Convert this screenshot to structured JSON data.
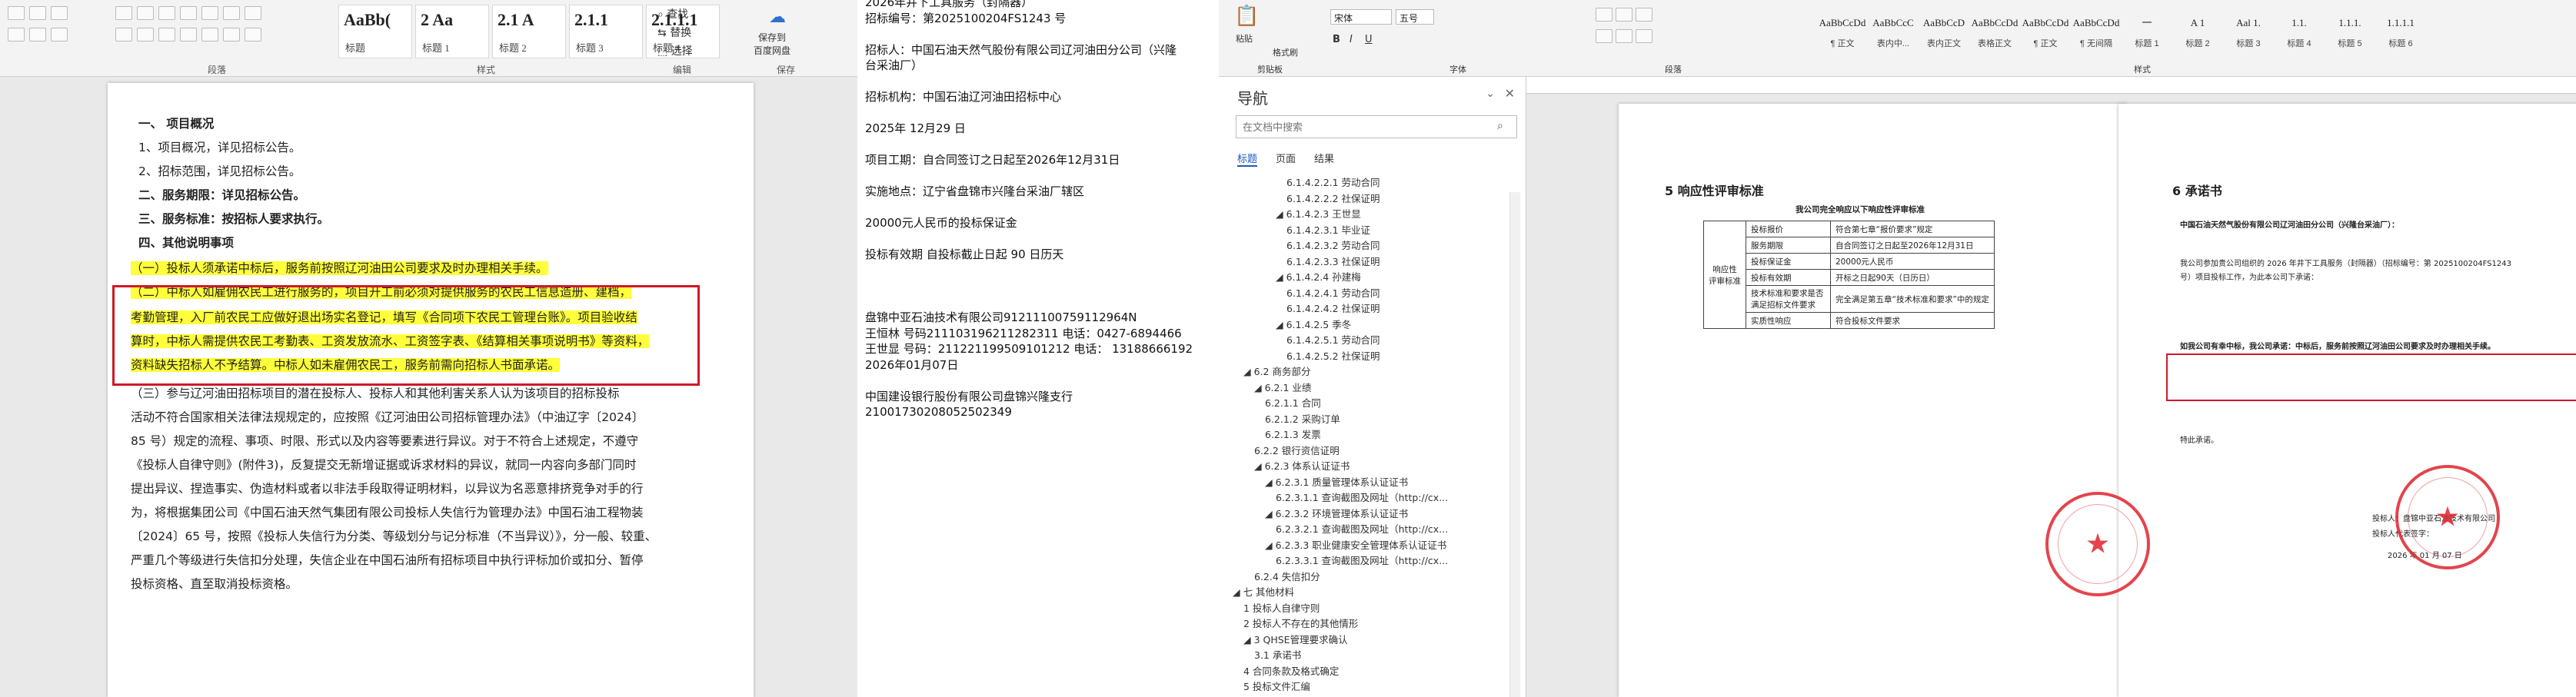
{
  "left_window": {
    "ribbon": {
      "styles": [
        {
          "sample": "AaBb(",
          "label": "标题"
        },
        {
          "sample": "2 Aa",
          "label": "标题 1"
        },
        {
          "sample": "2.1 A",
          "label": "标题 2"
        },
        {
          "sample": "2.1.1",
          "label": "标题 3"
        },
        {
          "sample": "2.1.1.1",
          "label": "标题 4"
        }
      ],
      "find": "查找",
      "replace": "替换",
      "select": "选择",
      "save_to": "保存到\n百度网盘",
      "group_paragraph": "段落",
      "group_styles": "样式",
      "group_edit": "编辑",
      "group_save": "保存"
    },
    "doc": {
      "lines": [
        {
          "text": "一、 项目概况",
          "bold": true
        },
        {
          "text": "1、项目概况，详见招标公告。"
        },
        {
          "text": "2、招标范围，详见招标公告。"
        },
        {
          "text": "二、服务期限：详见招标公告。",
          "bold": true
        },
        {
          "text": "三、服务标准：按招标人要求执行。",
          "bold": true
        },
        {
          "text": "四、其他说明事项",
          "bold": true
        },
        {
          "text": "（一）投标人须承诺中标后，服务前按照辽河油田公司要求及时办理相关手续。",
          "hl": true
        },
        {
          "text": "（二）中标人如雇佣农民工进行服务的，项目开工前必须对提供服务的农民工信息造册、建档，",
          "hl": true
        },
        {
          "text": "考勤管理，入厂前农民工应做好退出场实名登记，填写《合同项下农民工管理台账》。项目验收结",
          "hl": true
        },
        {
          "text": "算时，中标人需提供农民工考勤表、工资发放流水、工资签字表、《结算相关事项说明书》等资料，",
          "hl": true
        },
        {
          "text": "资料缺失招标人不予结算。中标人如未雇佣农民工，服务前需向招标人书面承诺。",
          "hl": true
        },
        {
          "text": "（三）参与辽河油田招标项目的潜在投标人、投标人和其他利害关系人认为该项目的招标投标"
        },
        {
          "text": "活动不符合国家相关法律法规规定的，应按照《辽河油田公司招标管理办法》（中油辽字〔2024〕"
        },
        {
          "text": "85 号）规定的流程、事项、时限、形式以及内容等要素进行异议。对于不符合上述规定，不遵守"
        },
        {
          "text": "《投标人自律守则》(附件3)，反复提交无新增证据或诉求材料的异议，就同一内容向多部门同时"
        },
        {
          "text": "提出异议、捏造事实、伪造材料或者以非法手段取得证明材料，以异议为名恶意排挤竞争对手的行"
        },
        {
          "text": "为，将根据集团公司《中国石油天然气集团有限公司投标人失信行为管理办法》中国石油工程物装"
        },
        {
          "text": "〔2024〕65 号，按照《投标人失信行为分类、等级划分与记分标准（不当异议）》，分一般、较重、"
        },
        {
          "text": "严重几个等级进行失信扣分处理，失信企业在中国石油所有招标项目中执行评标加价或扣分、暂停"
        },
        {
          "text": "投标资格、直至取消投标资格。"
        }
      ]
    }
  },
  "middle_text": {
    "lines": [
      "2026年井下工具服务（封隔器）",
      "招标编号：第2025100204FS1243 号",
      "",
      "招标人：中国石油天然气股份有限公司辽河油田分公司（兴隆",
      "台采油厂）",
      "",
      "招标机构：中国石油辽河油田招标中心",
      "",
      "2025年 12月29 日",
      "",
      "项目工期：自合同签订之日起至2026年12月31日",
      "",
      "实施地点：辽宁省盘锦市兴隆台采油厂辖区",
      "",
      "20000元人民币的投标保证金",
      "",
      "投标有效期              自投标截止日起  90  日历天",
      "",
      "",
      "",
      "盘锦中亚石油技术有限公司91211100759112964N",
      "王恒林  号码211103196211282311 电话：0427-6894466",
      "王世显  号码：211221199509101212  电话： 13188666192",
      "        2026年01月07日",
      "",
      "中国建设银行股份有限公司盘锦兴隆支行",
      "21001730208052502349"
    ]
  },
  "right_window": {
    "ribbon": {
      "font_name": "宋体",
      "font_size": "五号",
      "paste": "粘贴",
      "format_painter": "格式刷",
      "group_clipboard": "剪贴板",
      "group_font": "字体",
      "group_paragraph": "段落",
      "group_styles": "样式",
      "styles": [
        {
          "sample": "AaBbCcDd",
          "label": "¶ 正文"
        },
        {
          "sample": "AaBbCcC",
          "label": "表内中..."
        },
        {
          "sample": "AaBbCcD",
          "label": "表内正文"
        },
        {
          "sample": "AaBbCcDd",
          "label": "表格正文"
        },
        {
          "sample": "AaBbCcDd",
          "label": "¶ 正文"
        },
        {
          "sample": "AaBbCcDd",
          "label": "¶ 无间隔"
        },
        {
          "sample": "一",
          "label": "标题 1"
        },
        {
          "sample": "A 1",
          "label": "标题 2"
        },
        {
          "sample": "Aal 1.",
          "label": "标题 3"
        },
        {
          "sample": "1.1.",
          "label": "标题 4"
        },
        {
          "sample": "1.1.1.",
          "label": "标题 5"
        },
        {
          "sample": "1.1.1.1",
          "label": "标题 6"
        }
      ]
    },
    "nav": {
      "title": "导航",
      "search_placeholder": "在文档中搜索",
      "tabs": [
        "标题",
        "页面",
        "结果"
      ],
      "items": [
        {
          "text": "6.1.4.2.2.1 劳动合同",
          "level": 5
        },
        {
          "text": "6.1.4.2.2.2 社保证明",
          "level": 5
        },
        {
          "text": "◢ 6.1.4.2.3 王世显",
          "level": 4
        },
        {
          "text": "6.1.4.2.3.1 毕业证",
          "level": 5
        },
        {
          "text": "6.1.4.2.3.2 劳动合同",
          "level": 5
        },
        {
          "text": "6.1.4.2.3.3 社保证明",
          "level": 5
        },
        {
          "text": "◢ 6.1.4.2.4 孙建梅",
          "level": 4
        },
        {
          "text": "6.1.4.2.4.1 劳动合同",
          "level": 5
        },
        {
          "text": "6.1.4.2.4.2 社保证明",
          "level": 5
        },
        {
          "text": "◢ 6.1.4.2.5 季冬",
          "level": 4
        },
        {
          "text": "6.1.4.2.5.1 劳动合同",
          "level": 5
        },
        {
          "text": "6.1.4.2.5.2 社保证明",
          "level": 5
        },
        {
          "text": "◢ 6.2 商务部分",
          "level": 1
        },
        {
          "text": "◢ 6.2.1 业绩",
          "level": 2
        },
        {
          "text": "6.2.1.1 合同",
          "level": 3
        },
        {
          "text": "6.2.1.2 采购订单",
          "level": 3
        },
        {
          "text": "6.2.1.3 发票",
          "level": 3
        },
        {
          "text": "6.2.2 银行资信证明",
          "level": 2
        },
        {
          "text": "◢ 6.2.3 体系认证证书",
          "level": 2
        },
        {
          "text": "◢ 6.2.3.1 质量管理体系认证证书",
          "level": 3
        },
        {
          "text": "6.2.3.1.1 查询截图及网址（http://cx...",
          "level": 4
        },
        {
          "text": "◢ 6.2.3.2 环境管理体系认证证书",
          "level": 3
        },
        {
          "text": "6.2.3.2.1 查询截图及网址（http://cx...",
          "level": 4
        },
        {
          "text": "◢ 6.2.3.3 职业健康安全管理体系认证证书",
          "level": 3
        },
        {
          "text": "6.2.3.3.1 查询截图及网址（http://cx...",
          "level": 4
        },
        {
          "text": "6.2.4 失信扣分",
          "level": 2
        },
        {
          "text": "◢ 七 其他材料",
          "level": 0
        },
        {
          "text": "1 投标人自律守则",
          "level": 1
        },
        {
          "text": "2 投标人不存在的其他情形",
          "level": 1
        },
        {
          "text": "◢ 3 QHSE管理要求确认",
          "level": 1
        },
        {
          "text": "3.1 承诺书",
          "level": 2
        },
        {
          "text": "4 合同条款及格式确定",
          "level": 1
        },
        {
          "text": "5 投标文件汇编",
          "level": 1
        }
      ]
    },
    "page_a": {
      "heading": "5  响应性评审标准",
      "table_caption": "我公司完全响应以下响应性评审标准",
      "row_header": "响应性\n评审标准",
      "rows": [
        [
          "投标报价",
          "符合第七章“报价要求”规定"
        ],
        [
          "服务期限",
          "自合同签订之日起至2026年12月31日"
        ],
        [
          "投标保证金",
          "20000元人民币"
        ],
        [
          "投标有效期",
          "开标之日起90天（日历日）"
        ],
        [
          "技术标准和要求是否满足招标文件要求",
          "完全满足第五章“技术标准和要求”中的规定"
        ],
        [
          "实质性响应",
          "符合投标文件要求"
        ]
      ]
    },
    "page_b": {
      "heading": "6  承诺书",
      "addressee": "中国石油天然气股份有限公司辽河油田分公司（兴隆台采油厂）：",
      "body1": "    我公司参加贵公司组织的 2026 年井下工具服务（封隔器）（招标编号：第 2025100204FS1243",
      "body2": "号）项目投标工作，为此本公司下承诺：",
      "promise": "    如我公司有幸中标，我公司承诺：中标后，服务前按照辽河油田公司要求及时办理相关手续。",
      "sign1": "投标人：盘锦中亚石油技术有限公司",
      "sign2": "投标人代表签字：",
      "date": "2026 年 01 月 07 日",
      "special": "特此承诺。"
    }
  }
}
